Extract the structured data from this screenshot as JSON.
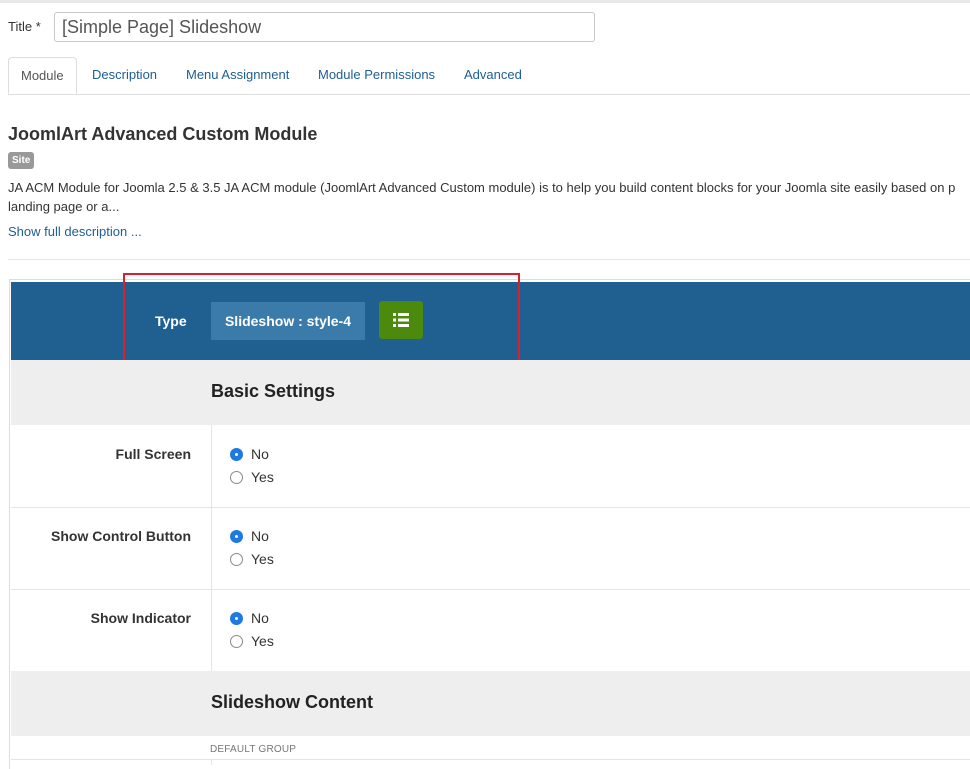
{
  "title_field": {
    "label": "Title *",
    "value": "[Simple Page] Slideshow"
  },
  "tabs": [
    {
      "label": "Module",
      "active": true
    },
    {
      "label": "Description",
      "active": false
    },
    {
      "label": "Menu Assignment",
      "active": false
    },
    {
      "label": "Module Permissions",
      "active": false
    },
    {
      "label": "Advanced",
      "active": false
    }
  ],
  "module": {
    "title": "JoomlArt Advanced Custom Module",
    "badge": "Site",
    "description": "JA ACM Module for Joomla 2.5 & 3.5 JA ACM module (JoomlArt Advanced Custom module) is to help you build content blocks for your Joomla site easily based on p\nlanding page or a...",
    "show_full_link": "Show full description ..."
  },
  "type_bar": {
    "label": "Type",
    "value": "Slideshow : style-4",
    "list_icon": "list-icon",
    "accent": "#1f6090",
    "button_color": "#4b8a0c",
    "highlight_color": "#d9202c"
  },
  "basic_settings": {
    "heading": "Basic Settings",
    "fields": [
      {
        "label": "Full Screen",
        "options": [
          "No",
          "Yes"
        ],
        "selected": "No"
      },
      {
        "label": "Show Control Button",
        "options": [
          "No",
          "Yes"
        ],
        "selected": "No"
      },
      {
        "label": "Show Indicator",
        "options": [
          "No",
          "Yes"
        ],
        "selected": "No"
      }
    ]
  },
  "slideshow_content": {
    "heading": "Slideshow Content",
    "group_label": "DEFAULT GROUP"
  }
}
